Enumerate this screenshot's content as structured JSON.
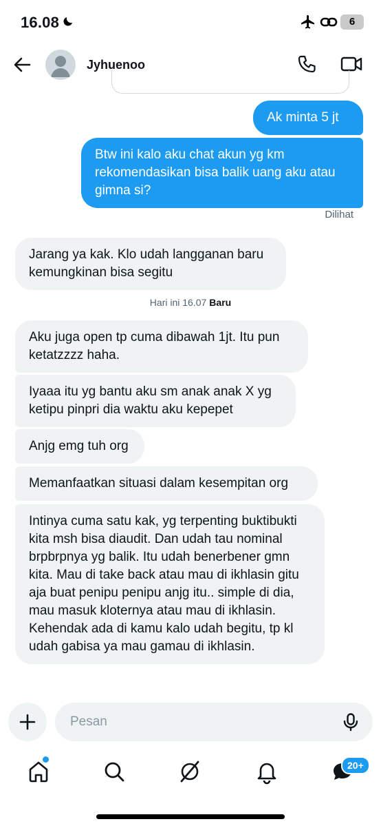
{
  "status_bar": {
    "time": "16.08",
    "battery": "6"
  },
  "header": {
    "contact_name": "Jyhuenoo"
  },
  "messages": [
    {
      "text": "Ak minta 5 jt"
    },
    {
      "text": "Btw ini kalo aku chat akun yg km rekomendasikan bisa balik uang aku atau gimna si?"
    },
    {
      "text": "Jarang ya kak. Klo udah langganan baru kemungkinan bisa segitu"
    },
    {
      "text": "Aku juga open tp cuma dibawah 1jt. Itu pun ketatzzzz haha."
    },
    {
      "text": "Iyaaa itu yg bantu aku sm anak anak X yg ketipu pinpri dia waktu aku kepepet"
    },
    {
      "text": "Anjg emg tuh org"
    },
    {
      "text": "Memanfaatkan situasi dalam kesempitan org"
    },
    {
      "text": "Intinya cuma satu kak, yg terpenting buktibukti kita msh bisa diaudit. Dan udah tau nominal brpbrpnya yg balik. Itu udah benerbener gmn kita. Mau di take back atau mau di ikhlasin gitu aja buat penipu penipu anjg itu.. simple di dia, mau masuk kloternya atau mau di ikhlasin. Kehendak ada di kamu kalo udah begitu, tp kl udah gabisa ya mau gamau di ikhlasin."
    }
  ],
  "seen_label": "Dilihat",
  "day_separator": {
    "time": "Hari ini 16.07",
    "new_label": "Baru"
  },
  "composer": {
    "placeholder": "Pesan"
  },
  "nav": {
    "messages_badge": "20+"
  },
  "colors": {
    "accent": "#1d9bf0",
    "incoming_bubble": "#eff3f4"
  }
}
